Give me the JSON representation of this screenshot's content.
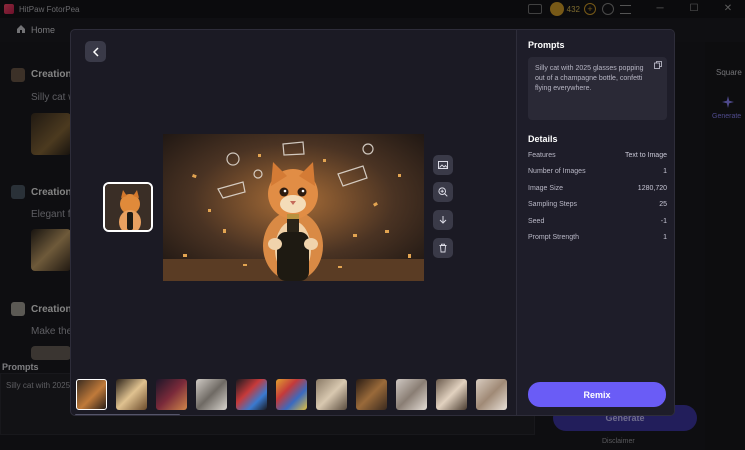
{
  "app": {
    "title": "HitPaw FotorPea",
    "credits": "432"
  },
  "nav": {
    "home": "Home"
  },
  "history": [
    {
      "title": "Creation",
      "prompt": "Silly cat w"
    },
    {
      "title": "Creation",
      "prompt": "Elegant fl"
    },
    {
      "title": "Creation",
      "prompt": "Make the"
    }
  ],
  "left_panel": {
    "prompts_label": "Prompts",
    "prompt_preview": "Silly cat with 2025"
  },
  "right_panel": {
    "square_label": "Square",
    "generate_tab": "Generate",
    "generate_button": "Generate",
    "disclaimer": "Disclaimer"
  },
  "modal": {
    "prompts_heading": "Prompts",
    "prompt_text": "Silly cat with 2025 glasses popping out of a champagne bottle, confetti flying everywhere.",
    "details_heading": "Details",
    "details": [
      {
        "key": "Features",
        "value": "Text to Image"
      },
      {
        "key": "Number of Images",
        "value": "1"
      },
      {
        "key": "Image Size",
        "value": "1280,720"
      },
      {
        "key": "Sampling Steps",
        "value": "25"
      },
      {
        "key": "Seed",
        "value": "-1"
      },
      {
        "key": "Prompt Strength",
        "value": "1"
      }
    ],
    "remix_button": "Remix",
    "tools": [
      "image-icon",
      "zoom-in-icon",
      "download-icon",
      "trash-icon"
    ]
  },
  "colors": {
    "accent": "#6a5cf6",
    "modal_bg": "#1b1a24",
    "panel_bg": "#1e1d29"
  }
}
